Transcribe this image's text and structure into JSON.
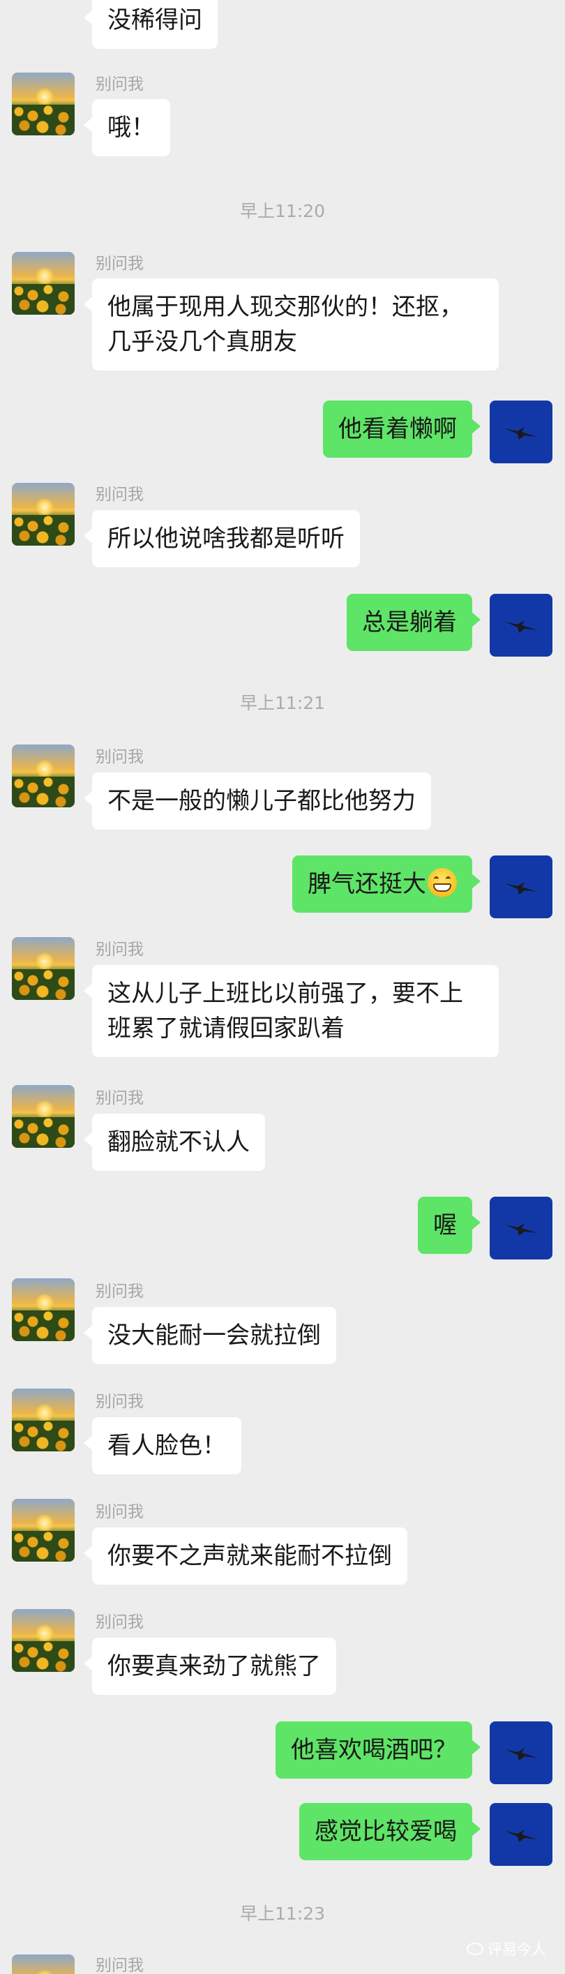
{
  "chat": {
    "contact_name": "别问我",
    "messages": [
      {
        "text": "没稀得问"
      },
      {
        "text": "哦！"
      },
      {
        "time": "早上11:20"
      },
      {
        "text": "他属于现用人现交那伙的！还抠，几乎没几个真朋友"
      },
      {
        "text": "他看着懒啊"
      },
      {
        "text": "所以他说啥我都是听听"
      },
      {
        "text": "总是躺着"
      },
      {
        "time": "早上11:21"
      },
      {
        "text": "不是一般的懒儿子都比他努力"
      },
      {
        "text": "脾气还挺大",
        "emoji": "grin-emoji"
      },
      {
        "text": "这从儿子上班比以前强了，要不上班累了就请假回家趴着"
      },
      {
        "text": "翻脸就不认人"
      },
      {
        "text": "喔"
      },
      {
        "text": "没大能耐一会就拉倒"
      },
      {
        "text": "看人脸色！"
      },
      {
        "text": "你要不之声就来能耐不拉倒"
      },
      {
        "text": "你要真来劲了就熊了"
      },
      {
        "text": "他喜欢喝酒吧？"
      },
      {
        "text": "感觉比较爱喝"
      },
      {
        "time": "早上11:23"
      }
    ]
  },
  "watermark": {
    "text": "评易今人"
  },
  "colors": {
    "background": "#ededed",
    "bubble_self": "#5ee466",
    "bubble_other": "#ffffff",
    "avatar_self": "#1238a8"
  }
}
